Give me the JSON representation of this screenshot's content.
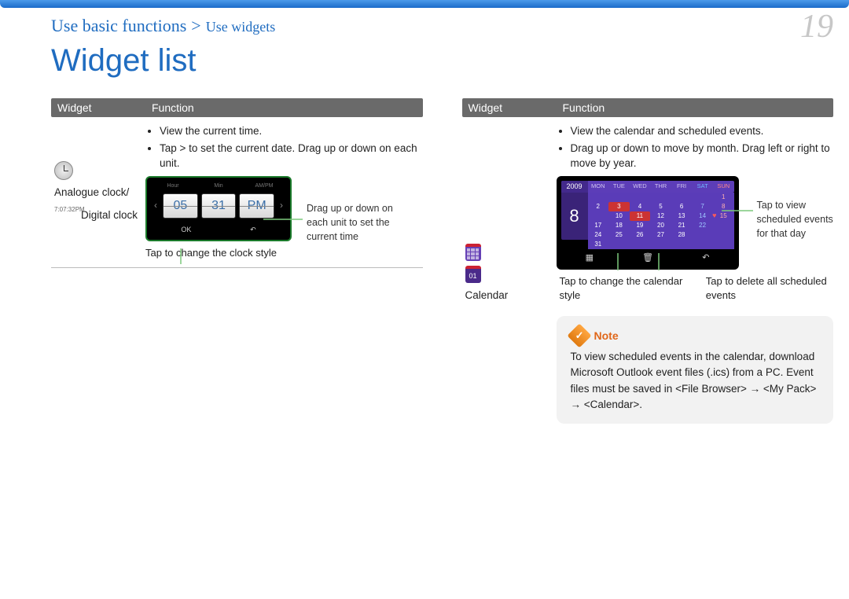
{
  "breadcrumb": {
    "section": "Use basic functions",
    "sep": ">",
    "page": "Use widgets"
  },
  "page_number": "19",
  "page_title": "Widget list",
  "table_headers": {
    "widget": "Widget",
    "function": "Function"
  },
  "clock_row": {
    "name_line1": "Analogue clock/",
    "name_line2": "Digital clock",
    "small_time_icon": "7:07:32PM",
    "bullets": [
      "View the current time.",
      "Tap > to set the current date. Drag up or down on each unit."
    ],
    "clock_labels": {
      "hour": "Hour",
      "min": "Min",
      "ampm": "AM/PM"
    },
    "tiles": {
      "hour": "05",
      "min": "31",
      "ampm": "PM"
    },
    "dev_bottom": {
      "ok": "OK",
      "back": "↶"
    },
    "callout_right": "Drag up or down on each unit to set the current time",
    "tap_caption": "Tap to change the clock style"
  },
  "calendar_row": {
    "name": "Calendar",
    "day_icon_text": "01",
    "bullets": [
      "View the calendar and scheduled events.",
      "Drag up or down to move by month. Drag left or right to move by year."
    ],
    "year": "2009",
    "big_day": "8",
    "day_headers": [
      "MON",
      "TUE",
      "WED",
      "THR",
      "FRI",
      "SAT",
      "SUN"
    ],
    "grid": [
      [
        "",
        "",
        "",
        "",
        "",
        "",
        "1"
      ],
      [
        "2",
        "3",
        "4",
        "5",
        "6",
        "7",
        "8"
      ],
      [
        "",
        "10",
        "11",
        "12",
        "13",
        "14",
        "15"
      ],
      [
        "17",
        "18",
        "19",
        "20",
        "21",
        "22",
        ""
      ],
      [
        "24",
        "25",
        "26",
        "27",
        "28",
        "",
        ""
      ],
      [
        "31",
        "",
        "",
        "",
        "",
        "",
        ""
      ]
    ],
    "callout_right": "Tap to view scheduled events for that day",
    "caption_left": "Tap to change the calendar style",
    "caption_right": "Tap to delete all scheduled events"
  },
  "note": {
    "title": "Note",
    "body": "To view scheduled events in the calendar, download Microsoft Outlook event files (.ics) from a PC. Event files must be saved in <File Browser> → <My Pack> → <Calendar>."
  }
}
